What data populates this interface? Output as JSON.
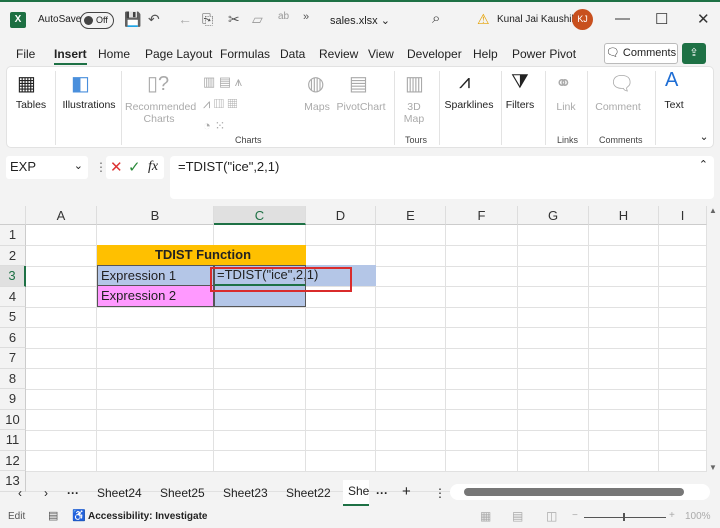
{
  "titlebar": {
    "autosave_label": "AutoSave",
    "autosave_state": "Off",
    "filename": "sales.xlsx ⌄",
    "user": "Kunal Jai Kaushik",
    "avatar_initials": "KJ"
  },
  "menu": [
    "File",
    "Insert",
    "Home",
    "Page Layout",
    "Formulas",
    "Data",
    "Review",
    "View",
    "Developer",
    "Help",
    "Power Pivot"
  ],
  "comments_label": "Comments",
  "ribbon": {
    "tables": "Tables",
    "illustrations": "Illustrations",
    "recommended_charts": "Recommended Charts",
    "maps": "Maps",
    "pivotchart": "PivotChart",
    "map3d": "3D Map",
    "sparklines": "Sparklines",
    "filters": "Filters",
    "link": "Link",
    "comment": "Comment",
    "text": "Text",
    "groups": {
      "charts": "Charts",
      "tours": "Tours",
      "links": "Links",
      "comments": "Comments"
    }
  },
  "formula_bar": {
    "name_box": "EXP",
    "formula": "=TDIST(\"ice\",2,1)",
    "fx": "fx"
  },
  "columns": [
    "A",
    "B",
    "C",
    "D",
    "E",
    "F",
    "G",
    "H",
    "I"
  ],
  "rows": [
    "1",
    "2",
    "3",
    "4",
    "5",
    "6",
    "7",
    "8",
    "9",
    "10",
    "11",
    "12",
    "13"
  ],
  "cells": {
    "B2": "TDIST Function",
    "B3": "Expression 1",
    "C3": "=TDIST(\"ice\",2,1)",
    "B4": "Expression 2"
  },
  "colors": {
    "header_fill": "#ffc000",
    "expr1_fill": "#b4c6e7",
    "expr2_fill": "#ff99ff",
    "highlight_border": "#d92b2b",
    "excel_green": "#1e7145"
  },
  "sheet_tabs": [
    "Sheet24",
    "Sheet25",
    "Sheet23",
    "Sheet22",
    "She"
  ],
  "active_sheet": "She",
  "status": {
    "mode": "Edit",
    "accessibility": "Accessibility: Investigate",
    "zoom": "100%"
  }
}
